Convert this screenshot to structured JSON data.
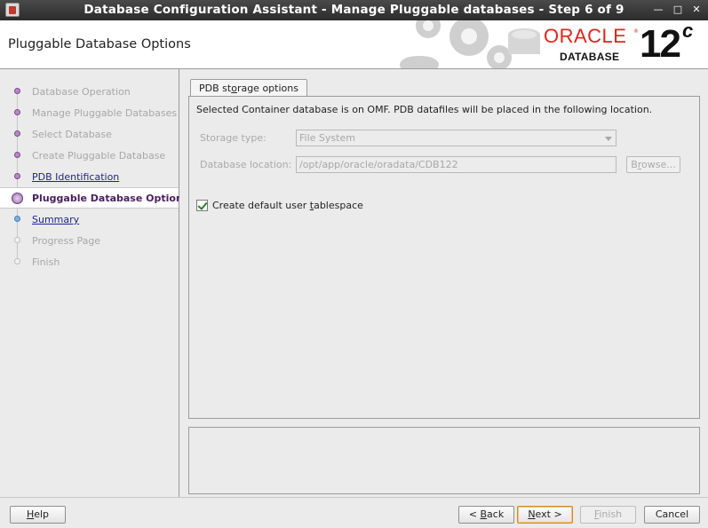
{
  "window": {
    "title": "Database Configuration Assistant - Manage Pluggable databases - Step 6 of 9",
    "controls": [
      "minimize",
      "maximize",
      "close"
    ]
  },
  "header": {
    "page_title": "Pluggable Database Options",
    "logo_text": "ORACLE",
    "logo_sub": "DATABASE",
    "version": "12",
    "version_suffix": "c"
  },
  "steps": [
    {
      "label": "Database Operation",
      "state": "done"
    },
    {
      "label": "Manage Pluggable Databases",
      "state": "done"
    },
    {
      "label": "Select Database",
      "state": "done"
    },
    {
      "label": "Create Pluggable Database",
      "state": "done"
    },
    {
      "label": "PDB Identification",
      "state": "link"
    },
    {
      "label": "Pluggable Database Options",
      "state": "current"
    },
    {
      "label": "Summary",
      "state": "next-link"
    },
    {
      "label": "Progress Page",
      "state": "pending"
    },
    {
      "label": "Finish",
      "state": "pending"
    }
  ],
  "tab": {
    "label_pre": "PDB st",
    "label_mnemonic": "o",
    "label_post": "rage options"
  },
  "panel": {
    "info_text": "Selected Container database is on OMF. PDB datafiles will be placed in the following location.",
    "storage_type_label": "Storage type:",
    "storage_type_value": "File System",
    "db_location_label": "Database location:",
    "db_location_value": "/opt/app/oracle/oradata/CDB122",
    "browse_pre": "B",
    "browse_mnemonic": "r",
    "browse_post": "owse...",
    "checkbox_pre": "Create default user ",
    "checkbox_mnemonic": "t",
    "checkbox_post": "ablespace",
    "checkbox_checked": true
  },
  "buttons": {
    "help_mnemonic": "H",
    "help_rest": "elp",
    "back_pre": "< ",
    "back_mnemonic": "B",
    "back_rest": "ack",
    "next_mnemonic": "N",
    "next_rest": "ext >",
    "finish_mnemonic": "F",
    "finish_rest": "inish",
    "cancel": "Cancel"
  },
  "colors": {
    "oracle_red": "#e2231a",
    "current_step": "#4a1e5e",
    "link": "#23238e"
  }
}
